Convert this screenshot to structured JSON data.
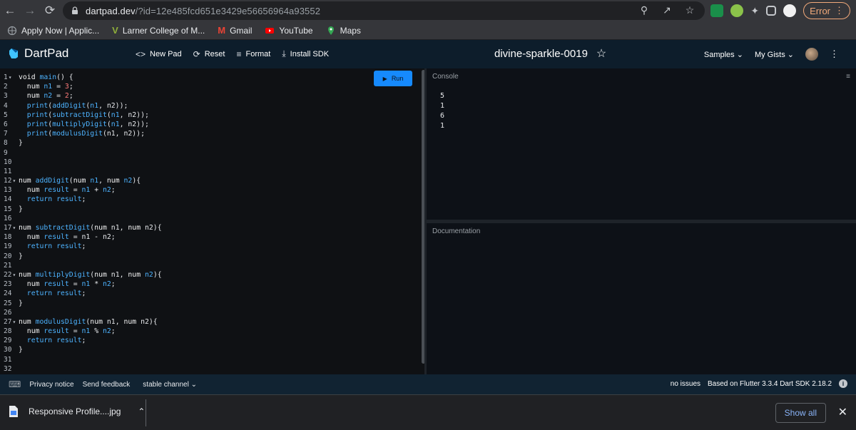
{
  "browser": {
    "url_host": "dartpad.dev",
    "url_path": "/?id=12e485fcd651e3429e56656964a93552",
    "error_label": "Error",
    "bookmarks": [
      {
        "label": "Apply Now | Applic..."
      },
      {
        "label": "Larner College of M..."
      },
      {
        "label": "Gmail"
      },
      {
        "label": "YouTube"
      },
      {
        "label": "Maps"
      }
    ]
  },
  "app": {
    "name": "DartPad",
    "toolbar": {
      "new_pad": "New Pad",
      "reset": "Reset",
      "format": "Format",
      "install_sdk": "Install SDK"
    },
    "gist_title": "divine-sparkle-0019",
    "samples": "Samples",
    "my_gists": "My Gists",
    "run_label": "Run"
  },
  "editor": {
    "line_numbers": [
      "1",
      "2",
      "3",
      "4",
      "5",
      "6",
      "7",
      "8",
      "9",
      "10",
      "11",
      "12",
      "13",
      "14",
      "15",
      "16",
      "17",
      "18",
      "19",
      "20",
      "21",
      "22",
      "23",
      "24",
      "25",
      "26",
      "27",
      "28",
      "29",
      "30",
      "31",
      "32"
    ],
    "fold_lines": [
      "1",
      "12",
      "17",
      "22",
      "27"
    ]
  },
  "console": {
    "label": "Console",
    "output": [
      "5",
      "1",
      "6",
      "1"
    ]
  },
  "docs": {
    "label": "Documentation"
  },
  "footer": {
    "privacy": "Privacy notice",
    "feedback": "Send feedback",
    "channel": "stable channel",
    "issues": "no issues",
    "sdk_info": "Based on Flutter 3.3.4 Dart SDK 2.18.2"
  },
  "downloads": {
    "file": "Responsive Profile....jpg",
    "show_all": "Show all"
  },
  "colors": {
    "accent": "#168afd",
    "header_bg": "#0d1d2b",
    "footer_bg": "#112332"
  }
}
